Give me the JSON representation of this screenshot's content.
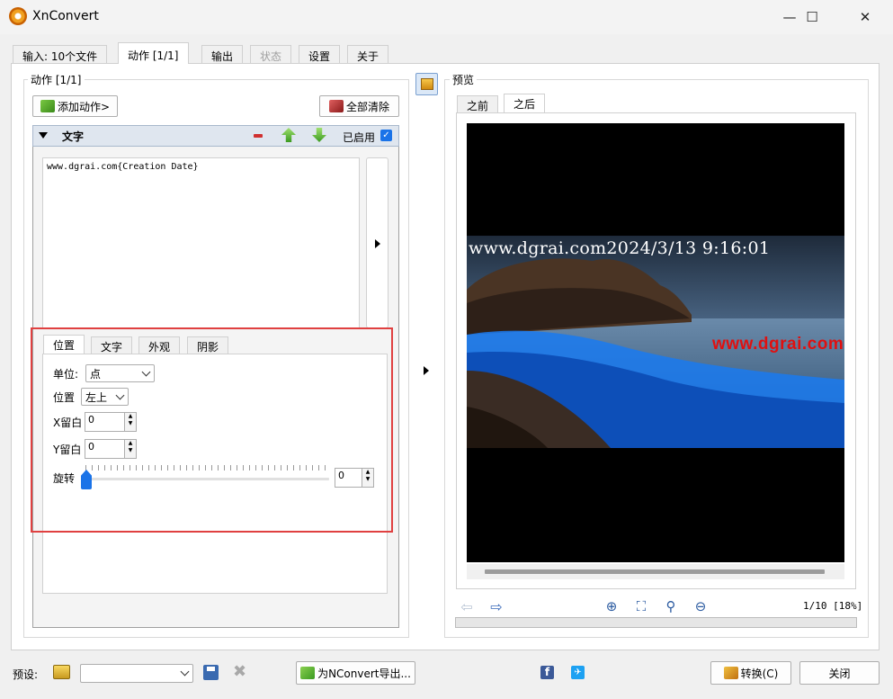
{
  "window": {
    "title": "XnConvert",
    "minimize": "—",
    "maximize": "☐",
    "close": "✕"
  },
  "main_tabs": [
    {
      "label": "输入: 10个文件"
    },
    {
      "label": "动作 [1/1]"
    },
    {
      "label": "输出"
    },
    {
      "label": "状态"
    },
    {
      "label": "设置"
    },
    {
      "label": "关于"
    }
  ],
  "actions_panel": {
    "group_label": "动作 [1/1]",
    "add_action_label": "添加动作>",
    "clear_all_label": "全部清除",
    "action": {
      "name": "文字",
      "enabled_label": "已启用",
      "enabled": true,
      "text_value": "www.dgrai.com{Creation Date}"
    },
    "subtabs": [
      {
        "label": "位置"
      },
      {
        "label": "文字"
      },
      {
        "label": "外观"
      },
      {
        "label": "阴影"
      }
    ],
    "unit_label": "单位:",
    "unit_value": "点",
    "position_label": "位置",
    "position_value": "左上",
    "x_margin_label": "X留白",
    "x_margin_value": "0",
    "y_margin_label": "Y留白",
    "y_margin_value": "0",
    "rotation_label": "旋转",
    "rotation_value": "0"
  },
  "preview": {
    "group_label": "预览",
    "tabs": [
      {
        "label": "之前"
      },
      {
        "label": "之后"
      }
    ],
    "overlay_text": "www.dgrai.com2024/3/13 9:16:01",
    "watermark": "www.dgrai.com",
    "page_info": "1/10 [18%]"
  },
  "footer": {
    "preset_label": "预设:",
    "preset_value": "",
    "export_label": "为NConvert导出...",
    "convert_label": "转换(C)",
    "close_label": "关闭"
  },
  "colors": {
    "accent": "#1a73e8",
    "highlight_box": "#e04040",
    "watermark": "#e01010",
    "action_header_bg": "#dfe6ef"
  }
}
